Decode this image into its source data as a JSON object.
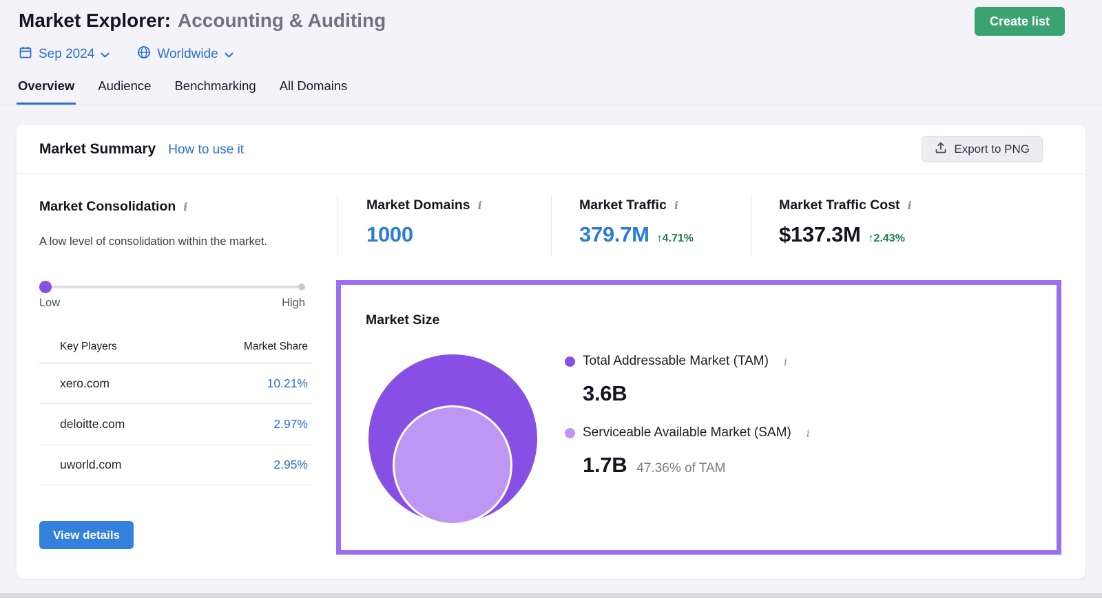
{
  "colors": {
    "accent_blue": "#2a6fd3",
    "value_blue": "#2b7cd9",
    "delta_green": "#1d7f4a",
    "create_list_green": "#3ba272",
    "primary_button_blue": "#3380dd",
    "tam_purple": "#874fe3",
    "sam_purple": "#bd97f3",
    "highlight_border_purple": "#9c6ff1"
  },
  "icons": {
    "info": "i"
  },
  "header": {
    "title_prefix": "Market Explorer:",
    "title_suffix": "Accounting & Auditing",
    "create_list_button": "Create list",
    "date_filter": "Sep 2024",
    "region_filter": "Worldwide",
    "tabs": [
      {
        "label": "Overview",
        "active": true
      },
      {
        "label": "Audience",
        "active": false
      },
      {
        "label": "Benchmarking",
        "active": false
      },
      {
        "label": "All Domains",
        "active": false
      }
    ]
  },
  "market_summary": {
    "title": "Market Summary",
    "help_link": "How to use it",
    "export_button": "Export to PNG",
    "consolidation": {
      "title": "Market Consolidation",
      "description": "A low level of consolidation within the market.",
      "slider": {
        "low_label": "Low",
        "high_label": "High",
        "position": "low"
      },
      "key_players_table": {
        "headers": {
          "player": "Key Players",
          "share": "Market Share"
        },
        "rows": [
          {
            "domain": "xero.com",
            "share": "10.21%"
          },
          {
            "domain": "deloitte.com",
            "share": "2.97%"
          },
          {
            "domain": "uworld.com",
            "share": "2.95%"
          }
        ]
      },
      "view_details_button": "View details"
    },
    "metrics": {
      "domains": {
        "label": "Market Domains",
        "value": "1000"
      },
      "traffic": {
        "label": "Market Traffic",
        "value": "379.7M",
        "delta": "↑4.71%"
      },
      "traffic_cost": {
        "label": "Market Traffic Cost",
        "value": "$137.3M",
        "delta": "↑2.43%"
      }
    },
    "market_size": {
      "title": "Market Size",
      "tam": {
        "label": "Total Addressable Market (TAM)",
        "value": "3.6B"
      },
      "sam": {
        "label": "Serviceable Available Market (SAM)",
        "value": "1.7B",
        "share_of_tam": "47.36% of TAM"
      }
    }
  }
}
